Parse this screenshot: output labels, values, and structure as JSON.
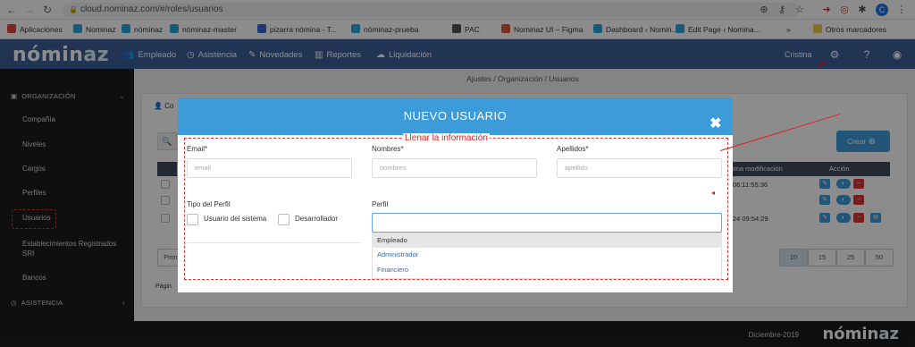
{
  "browser": {
    "url": "cloud.nominaz.com/#/roles/usuarios",
    "bookmarks": [
      {
        "label": "Aplicaciones",
        "color": "#e04a3a"
      },
      {
        "label": "Nominaz",
        "color": "#2aa9e0"
      },
      {
        "label": "nóminaz",
        "color": "#2aa9e0"
      },
      {
        "label": "nóminaz-master",
        "color": "#2aa9e0"
      },
      {
        "label": "pizarra nómina - T...",
        "color": "#3a66d6"
      },
      {
        "label": "nóminaz-prueba",
        "color": "#2aa9e0"
      },
      {
        "label": "PAC",
        "color": "#555555"
      },
      {
        "label": "Nominaz UI – Figma",
        "color": "#e0533a"
      },
      {
        "label": "Dashboard ‹ Nomin...",
        "color": "#2aa9e0"
      },
      {
        "label": "Edit Page ‹ Nomina...",
        "color": "#2aa9e0"
      }
    ],
    "bookmarks_more": "»",
    "other_bookmarks": "Otros marcadores",
    "profile_initial": "C"
  },
  "navbar": {
    "logo_left": "nómin",
    "logo_right": "az",
    "items": [
      {
        "label": "Empleado",
        "icon": "users-icon"
      },
      {
        "label": "Asistencia",
        "icon": "clock-icon"
      },
      {
        "label": "Novedades",
        "icon": "edit-icon"
      },
      {
        "label": "Reportes",
        "icon": "bar-chart-icon"
      },
      {
        "label": "Liquidación",
        "icon": "cloud-icon"
      }
    ],
    "user": "Cristina"
  },
  "sidebar": {
    "section1": "ORGANIZACIÓN",
    "items": [
      "Compañía",
      "Niveles",
      "Cargos",
      "Perfiles",
      "Usuarios",
      "Establecimientos Registrados SRI",
      "Bancos"
    ],
    "section2": "ASISTENCIA"
  },
  "breadcrumb": "Ajustes / Organización / Usuarios",
  "background": {
    "card_title_initial": "Co",
    "create_button": "Crear",
    "col_modified": "ima modificación",
    "col_action": "Acción",
    "rows": [
      "06:11:55:36",
      "",
      "24 09:54:29"
    ],
    "pager_first": "Prim",
    "page_label": "Págin",
    "page_sizes": [
      "10",
      "15",
      "25",
      "50"
    ]
  },
  "modal": {
    "title": "NUEVO USUARIO",
    "close": "✖",
    "annotation": "Llenar la información",
    "email_label": "Email*",
    "email_placeholder": "email",
    "nombres_label": "Nombres*",
    "nombres_placeholder": "nombres",
    "apellidos_label": "Apellidos*",
    "apellidos_placeholder": "apellido",
    "tipo_label": "Tipo del Perfil",
    "tipo_options": [
      "Usuario del sistema",
      "Desarrollador"
    ],
    "perfil_label": "Perfil",
    "perfil_options": [
      "Empleado",
      "Administrador",
      "Financiero"
    ]
  },
  "footer": {
    "date": "Diciembre-2019",
    "logo_left": "nómin",
    "logo_right": "az"
  },
  "colors": {
    "navbar": "#3c5f98",
    "modal_header": "#3e9bd9",
    "annotation": "#e02020"
  }
}
